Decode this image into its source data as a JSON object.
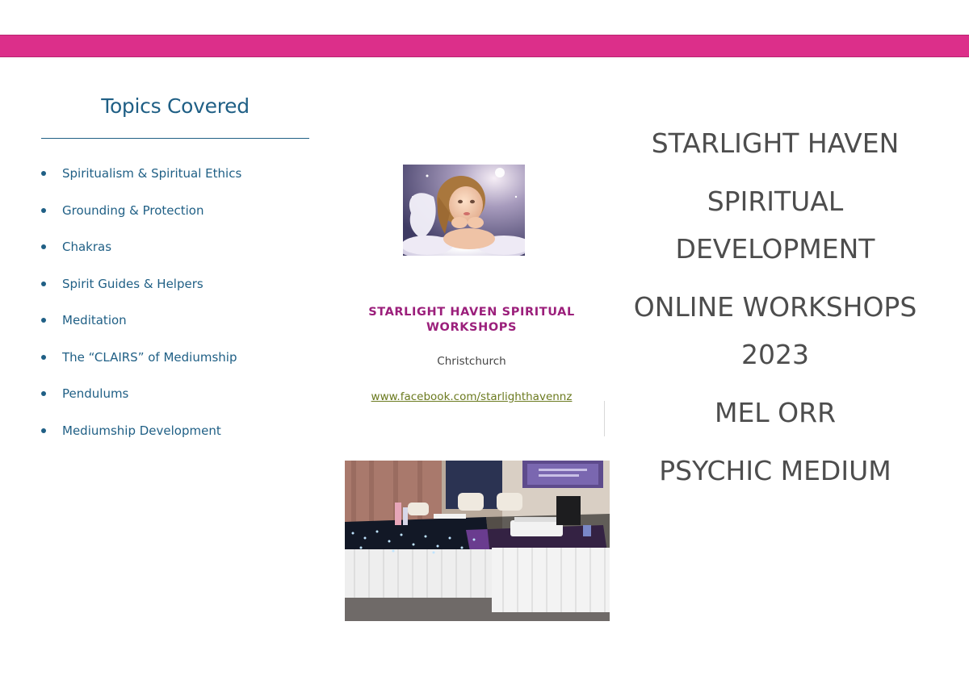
{
  "colors": {
    "accent_band": "#dc2f8a",
    "topics_text": "#1f5f85",
    "heading_magenta": "#9b1f7b",
    "cover_text": "#4d4d4d",
    "link_olive": "#6b7a1f"
  },
  "left_panel": {
    "title": "Topics Covered",
    "topics": [
      "Spiritualism & Spiritual Ethics",
      "Grounding & Protection",
      "Chakras",
      "Spirit Guides & Helpers",
      "Meditation",
      "The “CLAIRS” of Mediumship",
      "Pendulums",
      "Mediumship Development"
    ]
  },
  "middle_panel": {
    "angel_image": "angel-child-on-cloud-photo",
    "heading_line1": "STARLIGHT HAVEN SPIRITUAL",
    "heading_line2": "WORKSHOPS",
    "city": "Christchurch",
    "facebook_link": "www.facebook.com/starlighthavennz",
    "room_image": "workshop-room-tables-photo"
  },
  "right_panel": {
    "line1": "STARLIGHT HAVEN",
    "line2": "SPIRITUAL",
    "line3": "DEVELOPMENT",
    "line4": "ONLINE WORKSHOPS",
    "line5": "2023",
    "line6": "MEL ORR",
    "line7": "PSYCHIC MEDIUM"
  }
}
